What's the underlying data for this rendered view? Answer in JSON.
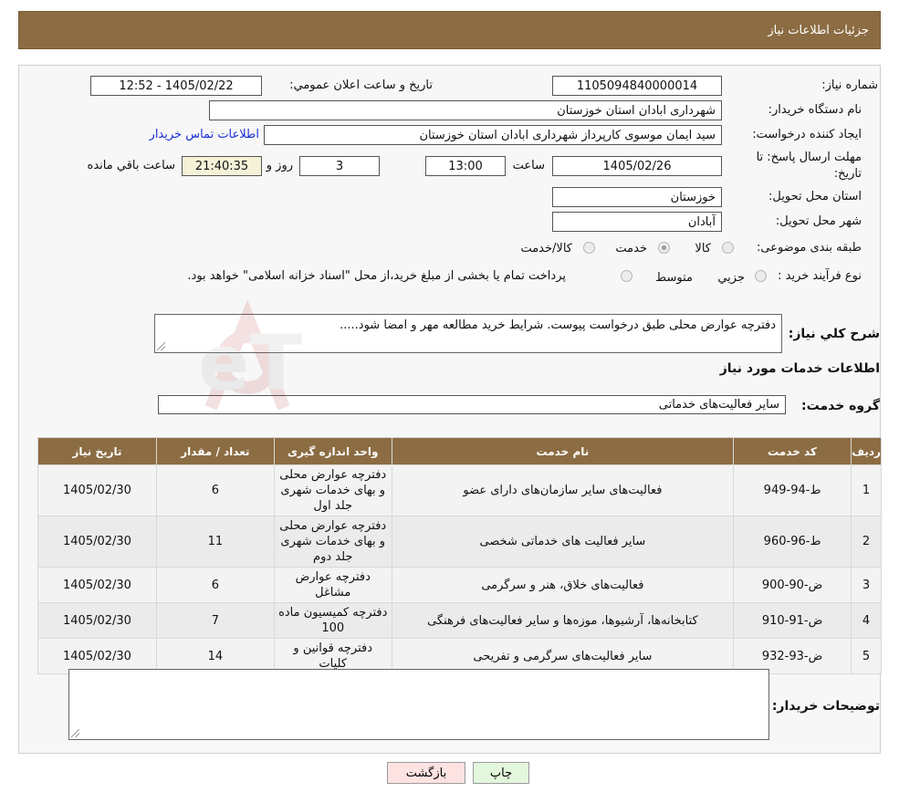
{
  "header": {
    "title": "جزئيات اطلاعات نياز"
  },
  "fields": {
    "need_number_label": "شماره نياز:",
    "need_number": "1105094840000014",
    "announce_label": "تاريخ و ساعت اعلان عمومي:",
    "announce_value": "1405/02/22 - 12:52",
    "buyer_org_label": "نام دستگاه خريدار:",
    "buyer_org": "شهرداری ابادان استان خوزستان",
    "creator_label": "ايجاد کننده درخواست:",
    "creator": "سید ایمان موسوی کارپرداز شهرداری ابادان استان خوزستان",
    "contact_link": "اطلاعات تماس خريدار",
    "deadline_label_1": "مهلت ارسال پاسخ: تا",
    "deadline_label_2": "تاريخ:",
    "deadline_date": "1405/02/26",
    "time_label": "ساعت",
    "deadline_time": "13:00",
    "days_value": "3",
    "days_label": "روز و",
    "remaining_time": "21:40:35",
    "remaining_label": "ساعت باقي مانده",
    "province_label": "استان محل تحويل:",
    "province": "خوزستان",
    "city_label": "شهر محل تحويل:",
    "city": "آبادان",
    "category_label": "طبقه بندی موضوعی:",
    "category_options": [
      "کالا",
      "خدمت",
      "کالا/خدمت"
    ],
    "category_selected": "خدمت",
    "process_label": "نوع فرآيند خريد :",
    "process_options": [
      "جزيي",
      "متوسط"
    ],
    "process_note": "پرداخت تمام یا بخشی از مبلغ خرید،از محل \"اسناد خزانه اسلامی\" خواهد بود."
  },
  "description": {
    "label": "شرح کلي نياز:",
    "text": "دفترچه عوارض محلی طبق درخواست پیوست. شرایط خرید مطالعه مهر و امضا شود....."
  },
  "services": {
    "section_title": "اطلاعات خدمات مورد نياز",
    "group_label": "گروه خدمت:",
    "group_value": "سایر فعالیت‌های خدماتی",
    "columns": [
      "رديف",
      "کد خدمت",
      "نام خدمت",
      "واحد اندازه گيری",
      "تعداد / مقدار",
      "تاريخ نياز"
    ],
    "rows": [
      {
        "idx": "1",
        "code": "ط-94-949",
        "name": "فعالیت‌های سایر سازمان‌های دارای عضو",
        "unit": "دفترچه عوارض محلی و بهای خدمات شهری جلد اول",
        "qty": "6",
        "date": "1405/02/30"
      },
      {
        "idx": "2",
        "code": "ط-96-960",
        "name": "سایر فعالیت های خدماتی شخصی",
        "unit": "دفترچه عوارض محلی و بهای خدمات شهری جلد دوم",
        "qty": "11",
        "date": "1405/02/30"
      },
      {
        "idx": "3",
        "code": "ض-90-900",
        "name": "فعالیت‌های خلاق، هنر و سرگرمی",
        "unit": "دفترچه عوارض مشاغل",
        "qty": "6",
        "date": "1405/02/30"
      },
      {
        "idx": "4",
        "code": "ض-91-910",
        "name": "کتابخانه‌ها، آرشیوها، موزه‌ها و سایر فعالیت‌های فرهنگی",
        "unit": "دفترچه کمیسیون ماده 100",
        "qty": "7",
        "date": "1405/02/30"
      },
      {
        "idx": "5",
        "code": "ض-93-932",
        "name": "سایر فعالیت‌های سرگرمی و تفریحی",
        "unit": "دفترچه قوانین و کلیات",
        "qty": "14",
        "date": "1405/02/30"
      }
    ]
  },
  "buyer_notes": {
    "label": "توضيحات خريدار:",
    "value": ""
  },
  "buttons": {
    "print": "چاپ",
    "back": "بازگشت"
  },
  "watermark": {
    "text": "AriaTender.neT"
  },
  "colors": {
    "header_bg": "#8c6c43",
    "link": "#1a2fd6"
  }
}
